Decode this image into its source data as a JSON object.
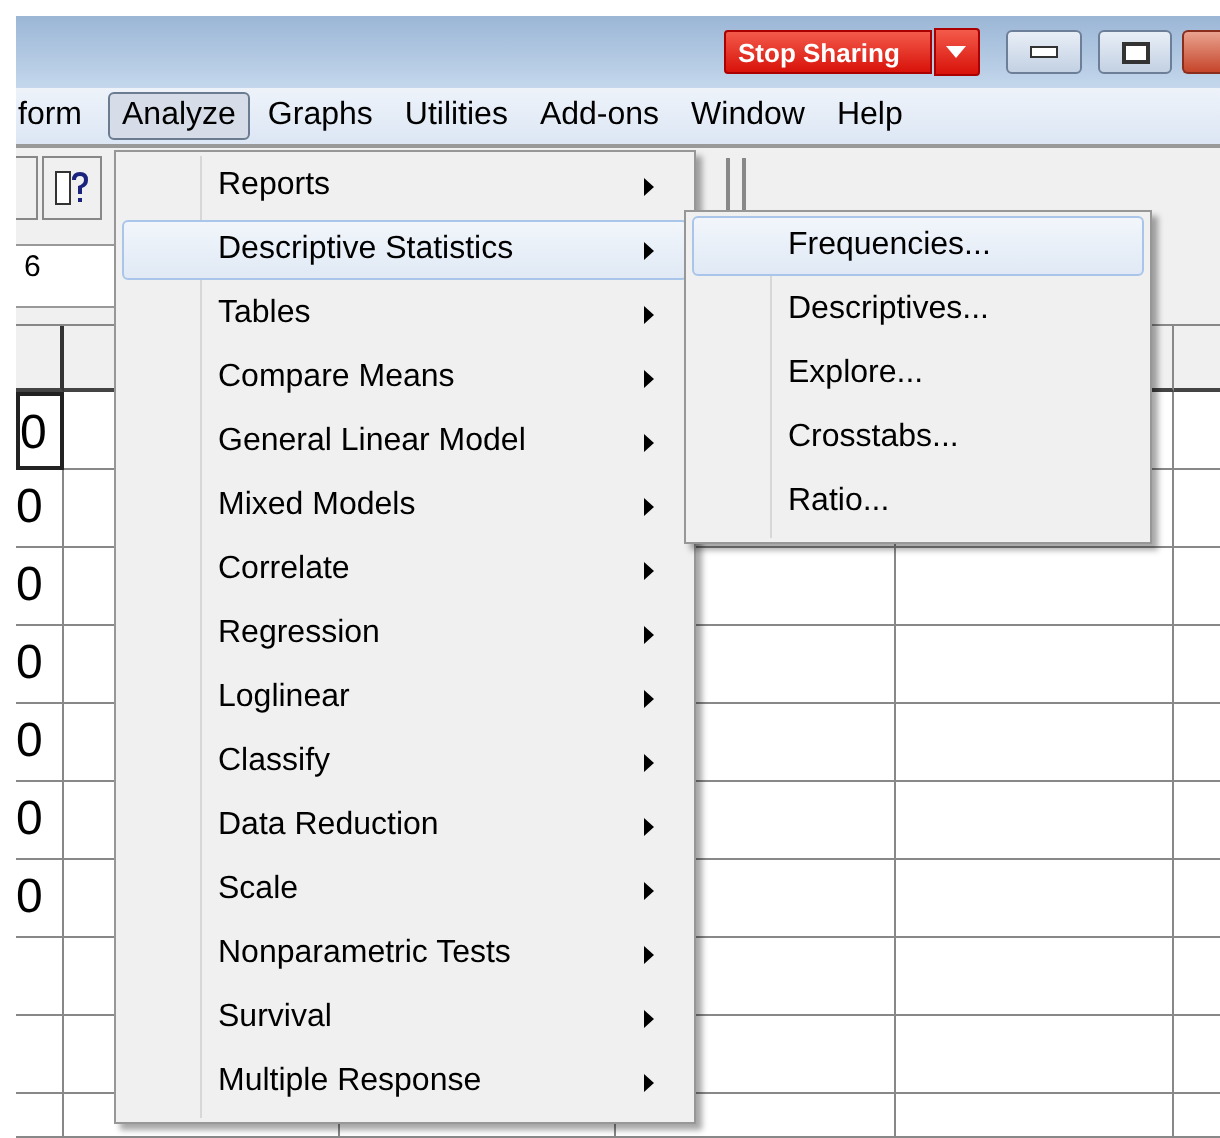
{
  "title_bar": {
    "share_button": "Stop Sharing"
  },
  "menubar": [
    {
      "label": "form",
      "selected": false
    },
    {
      "label": "Analyze",
      "selected": true
    },
    {
      "label": "Graphs",
      "selected": false
    },
    {
      "label": "Utilities",
      "selected": false
    },
    {
      "label": "Add-ons",
      "selected": false
    },
    {
      "label": "Window",
      "selected": false
    },
    {
      "label": "Help",
      "selected": false
    }
  ],
  "cell_editor": {
    "value": "6"
  },
  "grid": {
    "values": [
      "0",
      "0",
      "0",
      "0",
      "0",
      "0",
      "0"
    ]
  },
  "analyze_menu": [
    {
      "label": "Reports",
      "selected": false
    },
    {
      "label": "Descriptive Statistics",
      "selected": true
    },
    {
      "label": "Tables",
      "selected": false
    },
    {
      "label": "Compare Means",
      "selected": false
    },
    {
      "label": "General Linear Model",
      "selected": false
    },
    {
      "label": "Mixed Models",
      "selected": false
    },
    {
      "label": "Correlate",
      "selected": false
    },
    {
      "label": "Regression",
      "selected": false
    },
    {
      "label": "Loglinear",
      "selected": false
    },
    {
      "label": "Classify",
      "selected": false
    },
    {
      "label": "Data Reduction",
      "selected": false
    },
    {
      "label": "Scale",
      "selected": false
    },
    {
      "label": "Nonparametric Tests",
      "selected": false
    },
    {
      "label": "Survival",
      "selected": false
    },
    {
      "label": "Multiple Response",
      "selected": false
    }
  ],
  "submenu": [
    {
      "label": "Frequencies...",
      "selected": true
    },
    {
      "label": "Descriptives...",
      "selected": false
    },
    {
      "label": "Explore...",
      "selected": false
    },
    {
      "label": "Crosstabs...",
      "selected": false
    },
    {
      "label": "Ratio...",
      "selected": false
    }
  ]
}
